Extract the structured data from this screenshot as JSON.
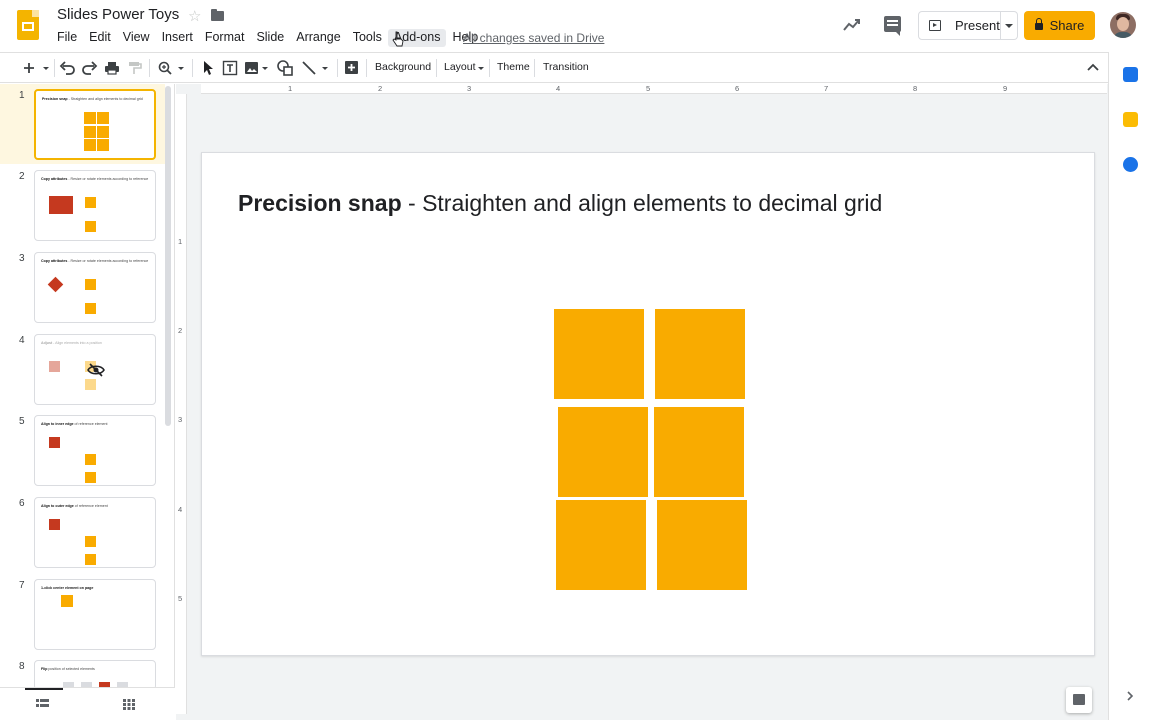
{
  "app": {
    "doc_title": "Slides Power Toys",
    "saved_status": "All changes saved in Drive"
  },
  "menu": [
    "File",
    "Edit",
    "View",
    "Insert",
    "Format",
    "Slide",
    "Arrange",
    "Tools",
    "Add-ons",
    "Help"
  ],
  "header_actions": {
    "present_label": "Present",
    "share_label": "Share"
  },
  "toolbar": {
    "background_label": "Background",
    "layout_label": "Layout",
    "theme_label": "Theme",
    "transition_label": "Transition"
  },
  "ruler": {
    "horizontal": [
      "1",
      "2",
      "3",
      "4",
      "5",
      "6",
      "7",
      "8",
      "9"
    ],
    "vertical": [
      "1",
      "2",
      "3",
      "4",
      "5"
    ]
  },
  "slides": [
    {
      "number": "1",
      "title_bold": "Precision snap",
      "title_rest": " - Straighten and align elements to decimal grid"
    },
    {
      "number": "2",
      "title_bold": "Copy attributes",
      "title_rest": " - Resize or rotate elements according to reference"
    },
    {
      "number": "3",
      "title_bold": "Copy attributes",
      "title_rest": " - Resize or rotate elements according to reference"
    },
    {
      "number": "4",
      "title_bold": "Adjust",
      "title_rest": " - Align elements into a position"
    },
    {
      "number": "5",
      "title_bold": "Align to inner edge",
      "title_rest": " of reference element"
    },
    {
      "number": "6",
      "title_bold": "Align to outer edge",
      "title_rest": " of reference element"
    },
    {
      "number": "7",
      "title_bold": "1-click center element on page",
      "title_rest": ""
    },
    {
      "number": "8",
      "title_bold": "Flip",
      "title_rest": " position of selected elements"
    }
  ],
  "current_slide": {
    "title_bold": "Precision snap",
    "title_rest": " - Straighten and align elements to decimal grid"
  },
  "colors": {
    "accent_yellow": "#f9ab00",
    "reference_red": "#c5391f"
  }
}
